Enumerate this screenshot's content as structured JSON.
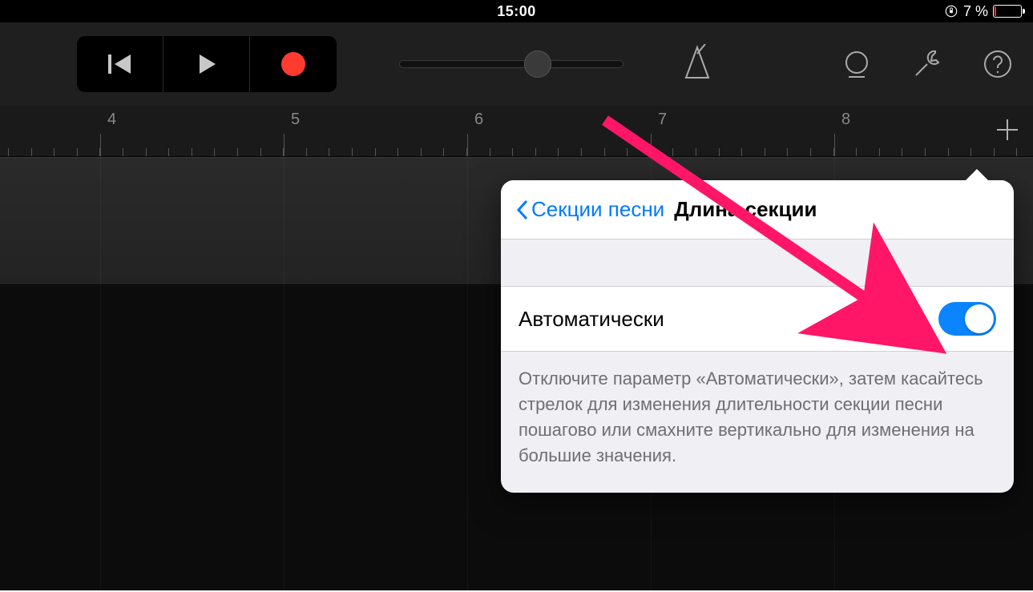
{
  "status": {
    "time": "15:00",
    "battery_text": "7 %",
    "battery_fill_pct": 7
  },
  "toolbar": {
    "rewind_icon": "skip-back",
    "play_icon": "play",
    "record_icon": "record"
  },
  "ruler": {
    "labels": [
      "4",
      "5",
      "6",
      "7",
      "8"
    ]
  },
  "popover": {
    "back_label": "Секции песни",
    "title": "Длина секции",
    "row": {
      "label": "Автоматически",
      "switch_on": true
    },
    "description": "Отключите параметр «Автоматически», затем касайтесь стрелок для изменения длительности секции песни пошагово или смахните вертикально для изменения на большие значения."
  },
  "colors": {
    "accent_blue": "#007aff",
    "record_red": "#ff3b30",
    "battery_low": "#ff3b30",
    "arrow_pink": "#ff1667"
  }
}
